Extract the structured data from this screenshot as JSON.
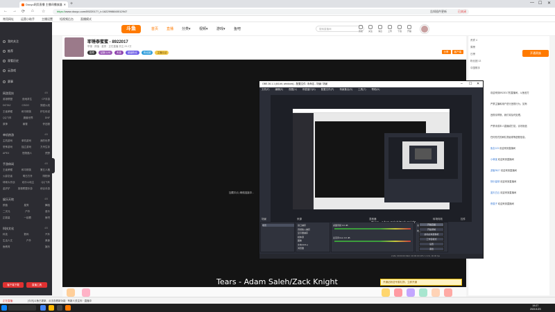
{
  "browser": {
    "tab_title": "Douyu网页直播 主播间播放器",
    "url_scheme": "https://",
    "url_rest": "www.douyu.com/8922017?_t=1622998840012947",
    "win_min": "—",
    "win_max": "☐",
    "win_close": "✕",
    "toolbar_right": [
      "告知插件更新",
      "已关闭"
    ],
    "bookmarks": [
      "常用网址",
      "运营小助手",
      "主播设置",
      "短视频后台",
      "直播模式"
    ]
  },
  "sidebar": {
    "items": [
      "我的关注",
      "推荐",
      "观看历史",
      "云游戏",
      "赛事"
    ],
    "sections": [
      {
        "title": "网游竞技",
        "count": "4/5",
        "rows": [
          [
            "英雄联盟",
            "绝地求生",
            "CF手游"
          ],
          [
            "DOTA2",
            "CSGO",
            "穿越火线"
          ],
          [
            "王者荣耀",
            "和平精英",
            "炉石传说"
          ],
          [
            "QQ飞车",
            "魔兽世界",
            "DNF"
          ],
          [
            "原神",
            "暴雪",
            "怀旧服"
          ]
        ]
      },
      {
        "title": "单机热游",
        "count": "4/5",
        "rows": [
          [
            "主机游戏",
            "单机游戏",
            "我的世界"
          ],
          [
            "恐怖游戏",
            "独立游戏",
            "方舟生存"
          ],
          [
            "APEX",
            "怪物猎人",
            "荒野"
          ]
        ]
      },
      {
        "title": "手游休闲",
        "count": "4/5",
        "rows": [
          [
            "王者荣耀",
            "和平精英",
            "第五人格"
          ],
          [
            "火影忍者",
            "明日方舟",
            "阴阳师"
          ],
          [
            "球球大作战",
            "欢乐斗地主",
            "QQ飞车"
          ],
          [
            "金铲铲",
            "英雄联盟手游",
            "综合手游"
          ]
        ]
      },
      {
        "title": "娱乐天地",
        "count": "4/5",
        "rows": [
          [
            "颜值",
            "星秀",
            "舞蹈"
          ],
          [
            "二次元",
            "户外",
            "音乐"
          ],
          [
            "正能量",
            "一起看",
            "鱼吧"
          ]
        ]
      },
      {
        "title": "科技文化",
        "count": "4/5",
        "rows": [
          [
            "科技",
            "数码",
            "汽车"
          ],
          [
            "生活人文",
            "户外",
            "美食"
          ],
          [
            "鱼教育",
            "娱乐"
          ]
        ]
      }
    ],
    "btn_left": "客户端下载",
    "btn_right": "直播工具"
  },
  "header": {
    "logo": "斗鱼",
    "nav": [
      "首页",
      "直播",
      "分类▾",
      "视频▾",
      "游戏▾",
      "鱼吧"
    ],
    "search_placeholder": "搜索直播间",
    "icons": [
      [
        "history-icon",
        "历史"
      ],
      [
        "follow-icon",
        "关注"
      ],
      [
        "message-icon",
        "消息"
      ],
      [
        "upload-icon",
        "上传"
      ],
      [
        "app-icon",
        "下载"
      ],
      [
        "start-live-icon",
        "开播"
      ]
    ]
  },
  "room": {
    "title": "耶锤泰蜜蜜 - 8922017",
    "meta": "举报  · 颜值 · 星秀 · 正在直播   关注  29.2万",
    "badges": [
      "勋章",
      "钻粉 LV5",
      "贵族",
      "超级粉丝",
      "粉丝团",
      "主播认证"
    ],
    "right_tags": [
      "分享",
      "客户端"
    ]
  },
  "right_col": {
    "rows": [
      "贵宾 4",
      "周榜",
      "日榜",
      "粉丝团 13",
      "中国歌手"
    ],
    "open_btn": "开通贵族",
    "chat": [
      {
        "name": "",
        "text": "欢迎来到8922017的直播间，斗鱼官方"
      },
      {
        "name": "",
        "text": "严禁主播和用户进行违规行为，如有"
      },
      {
        "name": "",
        "text": "违规请举报，我们将及时处理。"
      },
      {
        "name": "",
        "text": "严禁未成年人直播或打赏，请勿相信"
      },
      {
        "name": "",
        "text": "任何形式的刷礼物返现等虚假信息。"
      },
      {
        "name": "鱼友123",
        "text": " 欢迎来到直播间"
      },
      {
        "name": "小萌宝",
        "text": " 欢迎来到直播间"
      },
      {
        "name": "游客9527",
        "text": " 欢迎来到直播间"
      },
      {
        "name": "快乐星球",
        "text": " 欢迎来到直播间"
      },
      {
        "name": "蓝天白云",
        "text": " 欢迎来到直播间"
      },
      {
        "name": "夜猫子",
        "text": " 欢迎来到直播间"
      }
    ]
  },
  "video": {
    "center_text": "加载中(1) 网络连接中...",
    "song": "Tears - Adam Saleh/Zack Knight",
    "promo": "开通钻粉送专属礼物，立即开通"
  },
  "obs": {
    "title": "OBS 26.1.1 (64-bit, windows) - 配置文件: 未命名 - 场景: 场景",
    "menu": [
      "文件(F)",
      "编辑(E)",
      "视图(V)",
      "停靠窗口(D)",
      "配置文件(P)",
      "场景集合(S)",
      "工具(T)",
      "帮助(H)"
    ],
    "nested_song": "Tears - Adam Saleh/Zack Knight",
    "panel_heads": [
      "场景",
      "来源",
      "混音器",
      "转场特效",
      "控件"
    ],
    "scene": "场景",
    "sources": [
      "窗口捕获",
      "音频输入捕获",
      "显示器捕获",
      "媒体源",
      "图像",
      "文本(GDI+)",
      "浏览器"
    ],
    "mixer": [
      "桌面音频  0.0 dB",
      "麦克风/Aux  0.0 dB"
    ],
    "transition": [
      "淡出",
      "时长  300 ms"
    ],
    "controls": [
      "开始直播",
      "开始录制",
      "启动虚拟摄像机",
      "工作室模式",
      "设置",
      "退出"
    ],
    "status": "LIVE: 00:00:00   REC: 00:00:00   CPU: 2.1%, 30.00 fps"
  },
  "notif": {
    "left": "正在直播:",
    "mid": "[今天]斗鱼已更新，点击查看新功能  · 有新人关注你 · 直播中",
    "right": ""
  },
  "taskbar": {
    "time": "19:27",
    "date": "2021/1/23"
  }
}
